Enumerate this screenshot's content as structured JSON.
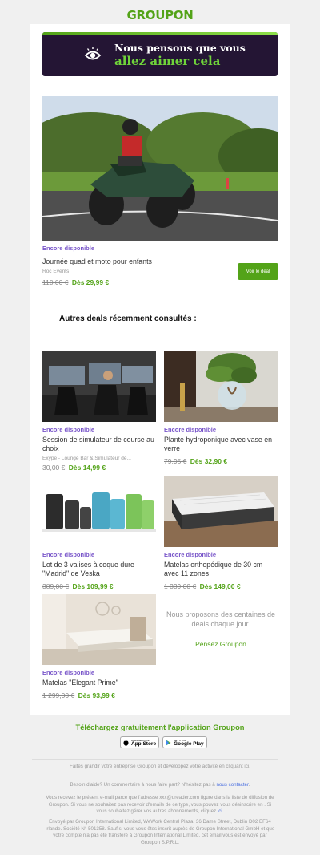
{
  "brand": {
    "logo": "GROUPON",
    "green": "#53a318",
    "purple": "#7855c9"
  },
  "hero_banner": {
    "line1": "Nous pensons que vous",
    "line2": "allez aimer cela",
    "icon": "eye-icon"
  },
  "featured": {
    "availability": "Encore disponible",
    "title": "Journée quad et moto pour enfants",
    "merchant": "Roc Events",
    "old_price": "110,00 €",
    "new_price": "Dès 29,99 €",
    "button": "Voir le deal"
  },
  "section_heading": "Autres deals récemment consultés :",
  "deals": [
    {
      "availability": "Encore disponible",
      "title": "Session de simulateur de course au choix",
      "merchant": "Exype - Lounge Bar & Simulateur de...",
      "old_price": "30,00 €",
      "new_price": "Dès 14,99 €"
    },
    {
      "availability": "Encore disponible",
      "title": "Plante hydroponique avec vase en verre",
      "merchant": "",
      "old_price": "79,95 €",
      "new_price": "Dès 32,90 €"
    },
    {
      "availability": "Encore disponible",
      "title": "Lot de 3 valises à coque dure \"Madrid\" de Veska",
      "merchant": "",
      "old_price": "389,00 €",
      "new_price": "Dès 109,99 €"
    },
    {
      "availability": "Encore disponible",
      "title": "Matelas orthopédique de 30 cm avec 11 zones",
      "merchant": "",
      "old_price": "1 339,00 €",
      "new_price": "Dès 149,00 €"
    },
    {
      "availability": "Encore disponible",
      "title": "Matelas \"Elegant Prime\"",
      "merchant": "",
      "old_price": "1 299,00 €",
      "new_price": "Dès 93,99 €"
    }
  ],
  "promo": {
    "text": "Nous proposons des centaines de deals chaque jour.",
    "link": "Pensez Groupon"
  },
  "app": {
    "title": "Téléchargez gratuitement l'application Groupon",
    "appstore_small": "Download on the",
    "appstore": "App Store",
    "googleplay_small": "GET IT ON",
    "googleplay": "Google Play"
  },
  "footer": {
    "business": "Faites grandir votre entreprise Groupon et développez votre activité en cliquant ici.",
    "help_prefix": "Besoin d'aide? Un commentaire à nous faire part? N'hésitez pas à ",
    "help_link": "nous contacter",
    "help_suffix": ".",
    "legal_main": "Vous recevez le présent e-mail parce que l'adresse xxx@ureader.com figure dans la liste de diffusion de Groupon. Si vous ne souhaitez pas recevoir d'emails de ce type, vous pouvez vous désinscrire en . Si vous souhaitez gérer vos autres abonnements, cliquez ",
    "legal_link": "ici",
    "legal_end": ".",
    "sender": "Envoyé par Groupon International Limited, WeWork Central Plaza, 36 Dame Street, Dublin D02 EF64 Irlande. Société N° 501358. Sauf si vous vous êtes inscrit auprès de Groupon International GmbH et que votre compte n'a pas été transféré à Groupon International Limited, cet email vous est envoyé par Groupon S.P.R.L."
  }
}
